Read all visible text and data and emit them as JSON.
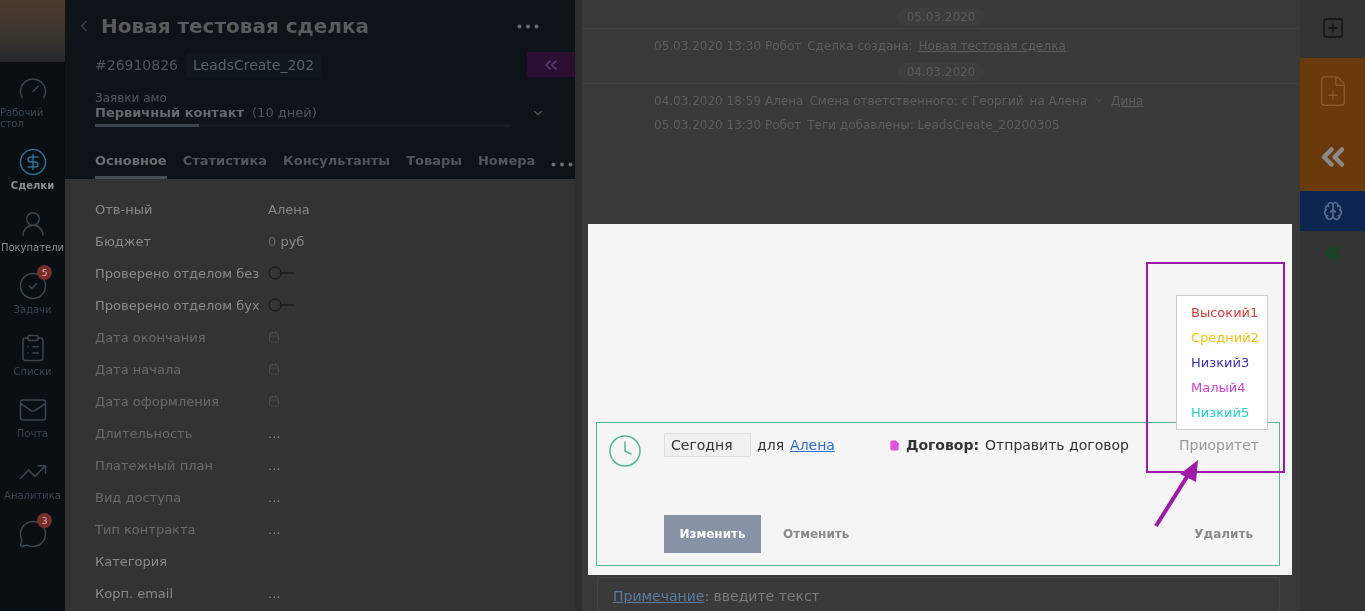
{
  "nav": [
    {
      "label": "Рабочий стол",
      "selected": false,
      "emphasized": false
    },
    {
      "label": "Сделки",
      "selected": true,
      "emphasized": true
    },
    {
      "label": "Покупатели",
      "selected": false,
      "emphasized": true
    },
    {
      "label": "Задачи",
      "selected": false,
      "emphasized": false,
      "badge": "5"
    },
    {
      "label": "Списки",
      "selected": false,
      "emphasized": false
    },
    {
      "label": "Почта",
      "selected": false,
      "emphasized": false
    },
    {
      "label": "Аналитика",
      "selected": false,
      "emphasized": false
    },
    {
      "selected": false,
      "badge": "3"
    }
  ],
  "deal": {
    "title": "Новая тестовая сделка",
    "number": "#26910826",
    "tag": "LeadsCreate_202",
    "pipeline": "Заявки амо",
    "stage": "Первичный контакт",
    "stage_duration": "(10 дней)",
    "stage_progress": {
      "level": 0.25
    },
    "tabs": [
      {
        "label": "Основное",
        "selected": true
      },
      {
        "label": "Статистика",
        "selected": false
      },
      {
        "label": "Консультанты",
        "selected": false
      },
      {
        "label": "Товары",
        "selected": false
      },
      {
        "label": "Номера",
        "selected": false
      }
    ],
    "fields": [
      {
        "label": "Отв-ный",
        "kind": "text",
        "value": "Алена",
        "muted": false
      },
      {
        "label": "Бюджет",
        "kind": "money",
        "value": "0",
        "unit": "руб",
        "muted": false
      },
      {
        "label": "Проверено отделом без",
        "kind": "toggle",
        "on": false,
        "muted": false
      },
      {
        "label": "Проверено отделом бух",
        "kind": "toggle",
        "on": false,
        "muted": false
      },
      {
        "label": "Дата окончания",
        "kind": "date",
        "muted": true
      },
      {
        "label": "Дата начала",
        "kind": "date",
        "muted": true
      },
      {
        "label": "Дата оформления",
        "kind": "date",
        "muted": true
      },
      {
        "label": "Длительность",
        "kind": "text",
        "value": "...",
        "muted": true
      },
      {
        "label": "Платежный план",
        "kind": "text",
        "value": "...",
        "muted": true
      },
      {
        "label": "Вид доступа",
        "kind": "text",
        "value": "...",
        "muted": true
      },
      {
        "label": "Тип контракта",
        "kind": "text",
        "value": "...",
        "muted": true
      },
      {
        "label": "Категория",
        "kind": "empty",
        "muted": false
      },
      {
        "label": "Корп. email",
        "kind": "text",
        "value": "...",
        "muted": false
      }
    ]
  },
  "feed": [
    {
      "kind": "date",
      "text": "05.03.2020"
    },
    {
      "kind": "event",
      "meta": "05.03.2020 13:30 Робот",
      "text": "Сделка создана:",
      "link": "Новая тестовая сделка"
    },
    {
      "kind": "date",
      "text": "04.03.2020"
    },
    {
      "kind": "event",
      "meta": "04.03.2020 18:59 Алена",
      "text": "Смена ответственного: с Георгий",
      "text_2": "на Алена",
      "link": "Дина"
    },
    {
      "kind": "event",
      "meta": "05.03.2020 13:30 Робот",
      "text": "Теги добавлены: LeadsCreate_20200305"
    }
  ],
  "task": {
    "date": "Сегодня",
    "for": "для",
    "user": "Алена",
    "type": "Договор:",
    "text": "Отправить договор",
    "priority": {
      "placeholder": "Приоритет"
    },
    "priority_options": [
      {
        "label": "Высокий1",
        "color": "#e53935"
      },
      {
        "label": "Средний2",
        "color": "#f4c20d"
      },
      {
        "label": "Низкий3",
        "color": "#3b2fc9"
      },
      {
        "label": "Малый4",
        "color": "#d63fd6"
      },
      {
        "label": "Низкий5",
        "color": "#1fd6c8"
      }
    ],
    "buttons": [
      {
        "label": "Изменить",
        "kind": "primary"
      },
      {
        "label": "Отменить",
        "kind": "plain"
      },
      {
        "label": "Удалить",
        "kind": "danger"
      }
    ]
  },
  "note": {
    "link": "Примечание",
    "placeholder": ": введите текст"
  }
}
